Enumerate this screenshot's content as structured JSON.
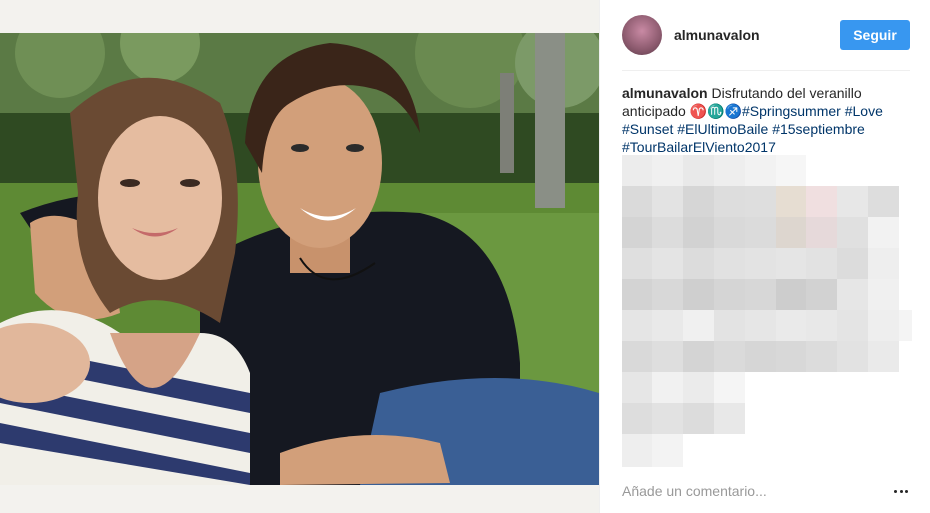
{
  "post": {
    "username": "almunavalon",
    "follow_label": "Seguir",
    "caption": {
      "username": "almunavalon",
      "text_prefix": " Disfrutando del veranillo anticipado ",
      "emoji": "♈♏♐",
      "hashtags": [
        "#Springsummer",
        "#Love",
        "#Sunset",
        "#ElUltimoBaile",
        "#15septiembre",
        "#TourBailarElViento2017"
      ]
    },
    "comment_placeholder": "Añade un comentario...",
    "more_icon": "ellipsis-icon"
  },
  "colors": {
    "follow_button": "#3897f0",
    "hashtag": "#003569",
    "text": "#262626",
    "placeholder": "#999999"
  }
}
